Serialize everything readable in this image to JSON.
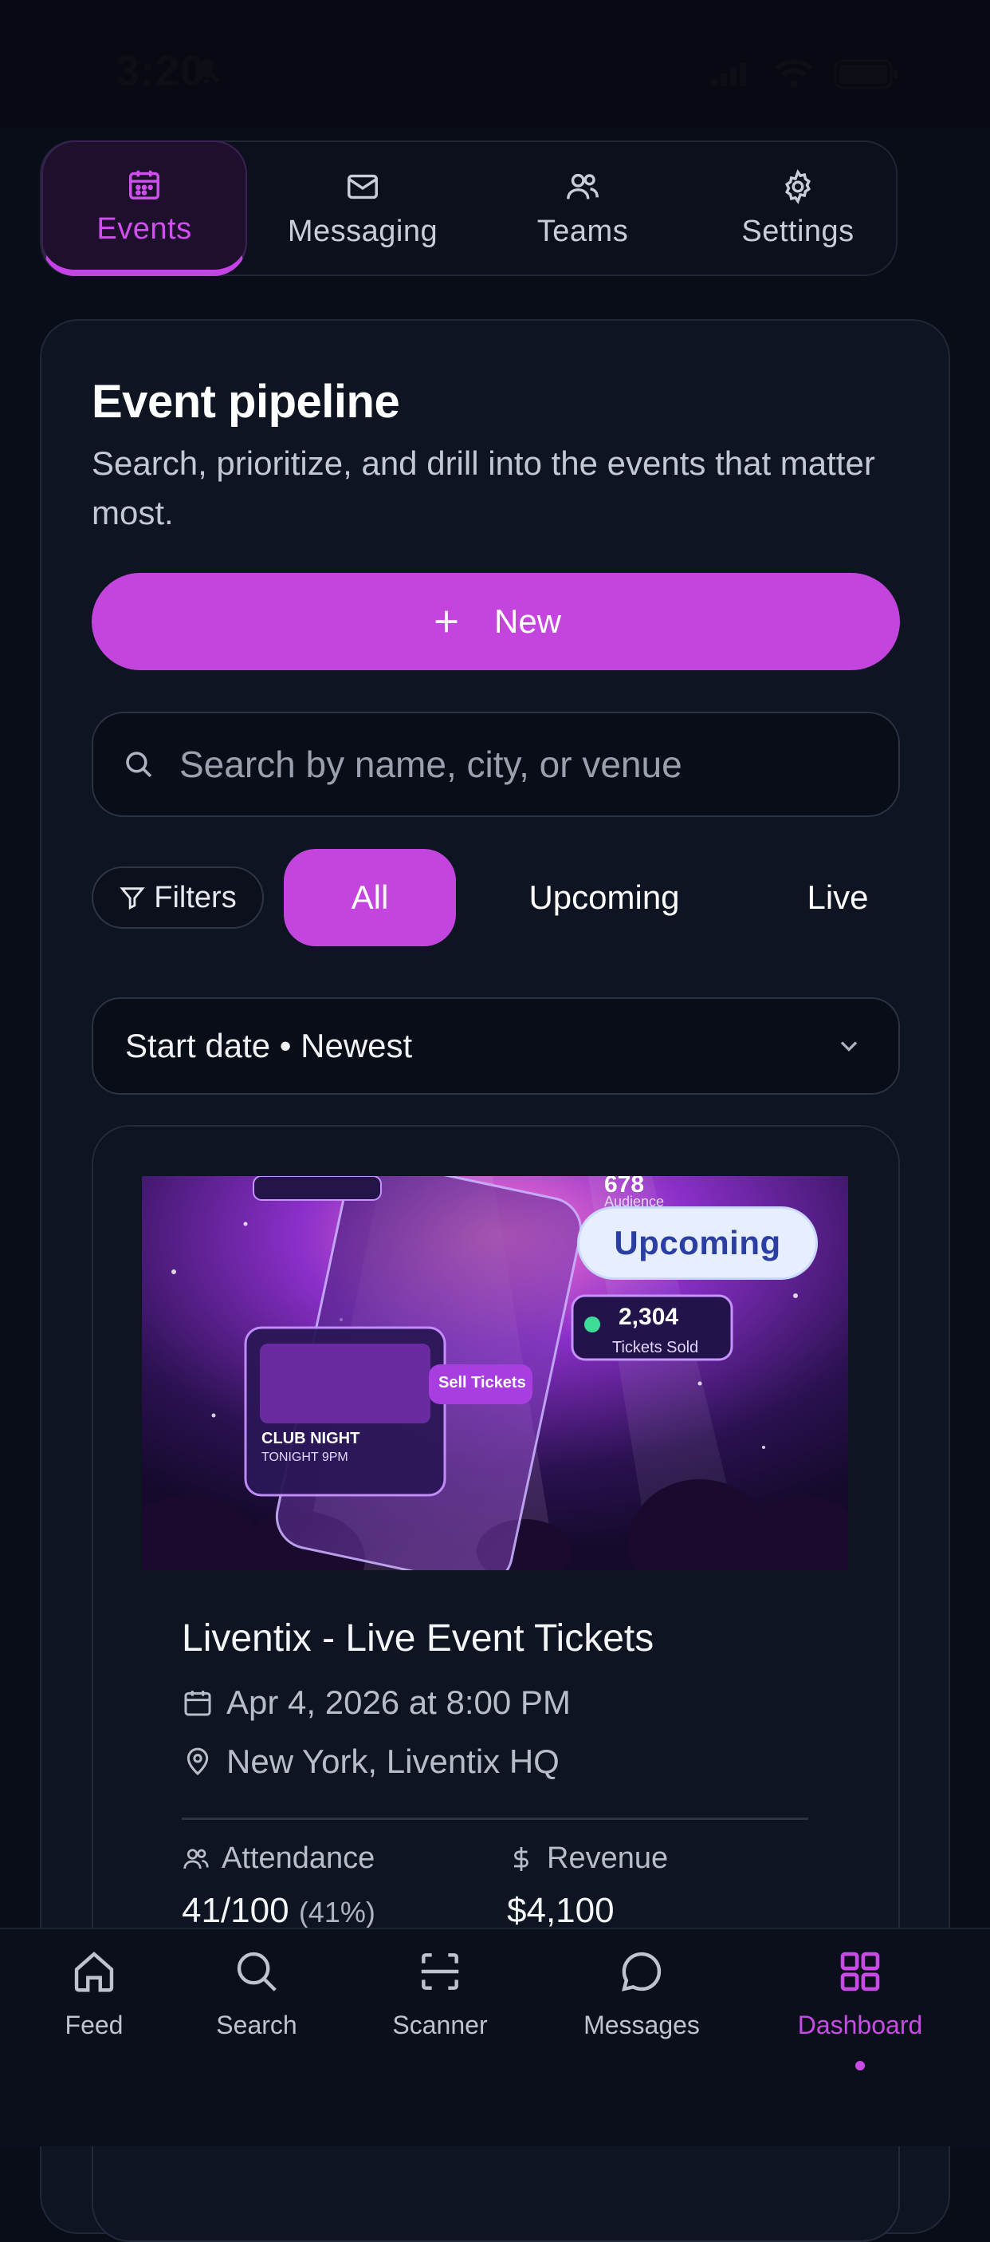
{
  "status_bar": {
    "time": "3:20"
  },
  "top_tabs": [
    {
      "label": "Events",
      "icon": "calendar-icon",
      "active": true
    },
    {
      "label": "Messaging",
      "icon": "mail-icon",
      "active": false
    },
    {
      "label": "Teams",
      "icon": "users-icon",
      "active": false
    },
    {
      "label": "Settings",
      "icon": "gear-icon",
      "active": false
    }
  ],
  "pipeline": {
    "title": "Event pipeline",
    "subtitle": "Search, prioritize, and drill into the events that matter most.",
    "new_button": "New",
    "search_placeholder": "Search by name, city, or venue",
    "filters_label": "Filters",
    "chips": [
      "All",
      "Upcoming",
      "Live"
    ],
    "active_chip": "All",
    "sort_label": "Start date • Newest"
  },
  "event": {
    "badge": "Upcoming",
    "hero_texts": {
      "tickets_sold_value": "2,304",
      "tickets_sold_label": "Tickets Sold",
      "audience_value": "678",
      "audience_label": "Audience",
      "sell_tickets": "Sell Tickets",
      "club_night": "CLUB NIGHT",
      "tonight": "TONIGHT 9PM"
    },
    "title": "Liventix - Live Event Tickets",
    "date": "Apr 4, 2026 at 8:00 PM",
    "location": "New York, Liventix HQ",
    "attendance_label": "Attendance",
    "attendance_value": "41/100",
    "attendance_pct": "(41%)",
    "revenue_label": "Revenue",
    "revenue_value": "$4,100"
  },
  "bottom_nav": [
    {
      "label": "Feed",
      "icon": "home-icon",
      "active": false
    },
    {
      "label": "Search",
      "icon": "search-icon",
      "active": false
    },
    {
      "label": "Scanner",
      "icon": "scan-icon",
      "active": false
    },
    {
      "label": "Messages",
      "icon": "chat-bubble-icon",
      "active": false
    },
    {
      "label": "Dashboard",
      "icon": "dashboard-grid-icon",
      "active": true
    }
  ],
  "colors": {
    "accent": "#c444de",
    "background": "#090d17",
    "card": "#0e1422"
  }
}
